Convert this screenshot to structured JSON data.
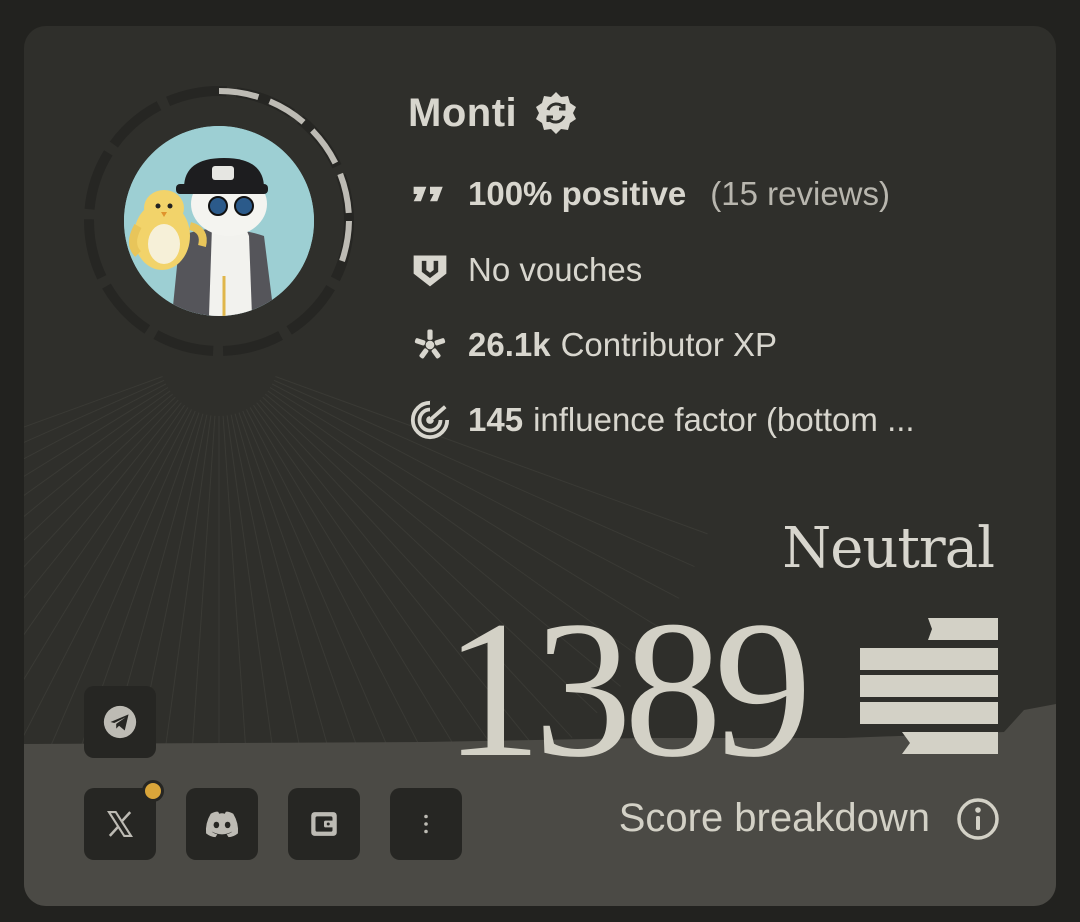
{
  "profile": {
    "name": "Monti",
    "avatar_icon": "penguin-avatar",
    "verified_icon": "verified-badge-icon"
  },
  "stats": {
    "reviews": {
      "icon": "reviews-icon",
      "value": "100% positive",
      "detail": "(15 reviews)"
    },
    "vouches": {
      "icon": "vouch-shield-icon",
      "text": "No vouches"
    },
    "xp": {
      "icon": "xp-star-icon",
      "value": "26.1k",
      "text": "Contributor XP"
    },
    "influence": {
      "icon": "influence-target-icon",
      "value": "145",
      "text": "influence factor (bottom ..."
    }
  },
  "score": {
    "level": "Neutral",
    "value": "1389",
    "breakdown_label": "Score breakdown"
  },
  "socials": [
    {
      "name": "telegram",
      "icon": "telegram-icon"
    },
    {
      "name": "x",
      "icon": "x-icon",
      "has_notification": true
    },
    {
      "name": "discord",
      "icon": "discord-icon"
    },
    {
      "name": "wallet",
      "icon": "wallet-icon"
    },
    {
      "name": "more",
      "icon": "more-icon"
    }
  ],
  "colors": {
    "background": "#22221f",
    "card": "#2f2f2b",
    "ground": "#4b4a45",
    "text": "#d8d6ce",
    "accent_dot": "#d9a53a"
  }
}
